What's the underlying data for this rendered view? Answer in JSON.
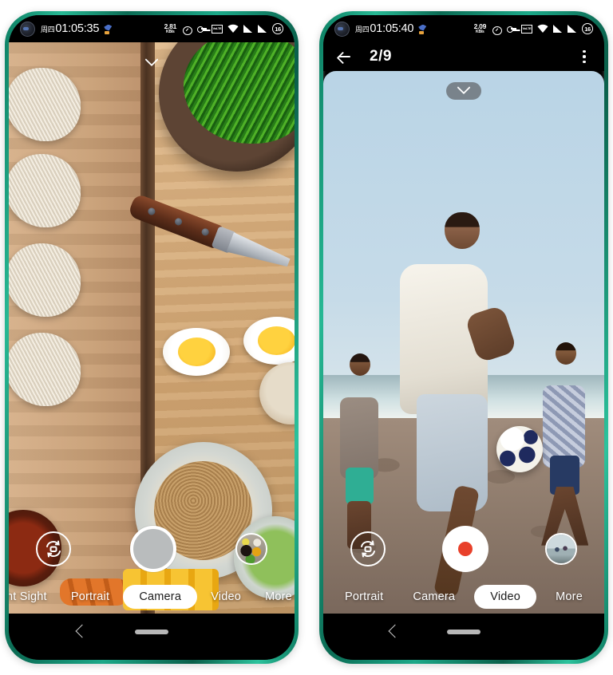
{
  "phones": [
    {
      "id": "phone-1",
      "status_bar": {
        "day": "周四",
        "time": "01:05:35",
        "app_icon": "bird-app-icon",
        "net_speed_value": "2.81",
        "net_speed_unit": "KB/s",
        "alarm_icon": "alarm-clock-icon",
        "key_icon": "key-icon",
        "volte_text": "VoLTE",
        "wifi_icon": "wifi-icon",
        "signal_1_icon": "signal-bars-icon",
        "signal_2_icon": "signal-bars-icon",
        "battery_level": "16"
      },
      "viewfinder": {
        "scene": "food-photo-noodles-eggs",
        "expand_control": "chevron-down-icon"
      },
      "controls": {
        "flip_camera": "camera-flip-icon",
        "shutter": "photo-shutter-button",
        "thumbnail": "gallery-thumbnail-food"
      },
      "modes": [
        {
          "label": "ht Sight",
          "active": false
        },
        {
          "label": "Portrait",
          "active": false
        },
        {
          "label": "Camera",
          "active": true
        },
        {
          "label": "Video",
          "active": false
        },
        {
          "label": "More",
          "active": false
        }
      ],
      "nav": {
        "back": "back-chevron-icon",
        "home": "home-pill-indicator"
      }
    },
    {
      "id": "phone-2",
      "status_bar": {
        "day": "周四",
        "time": "01:05:40",
        "app_icon": "bird-app-icon",
        "net_speed_value": "2.09",
        "net_speed_unit": "KB/s",
        "alarm_icon": "alarm-clock-icon",
        "key_icon": "key-icon",
        "volte_text": "VoLTE",
        "wifi_icon": "wifi-icon",
        "signal_1_icon": "signal-bars-icon",
        "signal_2_icon": "signal-bars-icon",
        "battery_level": "16"
      },
      "header": {
        "back_icon": "arrow-left-icon",
        "title": "2/9",
        "menu_icon": "more-vertical-icon"
      },
      "viewfinder": {
        "scene": "beach-soccer-photo",
        "expand_control": "chevron-down-icon"
      },
      "controls": {
        "flip_camera": "camera-flip-icon",
        "shutter": "video-record-button",
        "thumbnail": "gallery-thumbnail-beach"
      },
      "modes": [
        {
          "label": "Portrait",
          "active": false
        },
        {
          "label": "Camera",
          "active": false
        },
        {
          "label": "Video",
          "active": true
        },
        {
          "label": "More",
          "active": false
        }
      ],
      "nav": {
        "back": "back-chevron-icon",
        "home": "home-pill-indicator"
      }
    }
  ],
  "colors": {
    "frame_green": "#1ba888",
    "record_red": "#e8402a",
    "active_pill": "#ffffff",
    "status_bg": "#000000"
  }
}
